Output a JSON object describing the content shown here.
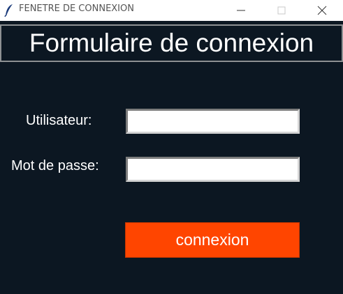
{
  "window": {
    "title": "FENETRE DE CONNEXION",
    "app_icon": "feather-icon",
    "controls": [
      "minimize-icon",
      "maximize-icon",
      "close-icon"
    ]
  },
  "form": {
    "heading": "Formulaire de connexion",
    "username_label": "Utilisateur:",
    "username_value": "",
    "password_label": "Mot de passe:",
    "password_value": "",
    "submit_label": "connexion"
  },
  "colors": {
    "background": "#0c1722",
    "button": "#ff4500",
    "text": "#ffffff"
  }
}
